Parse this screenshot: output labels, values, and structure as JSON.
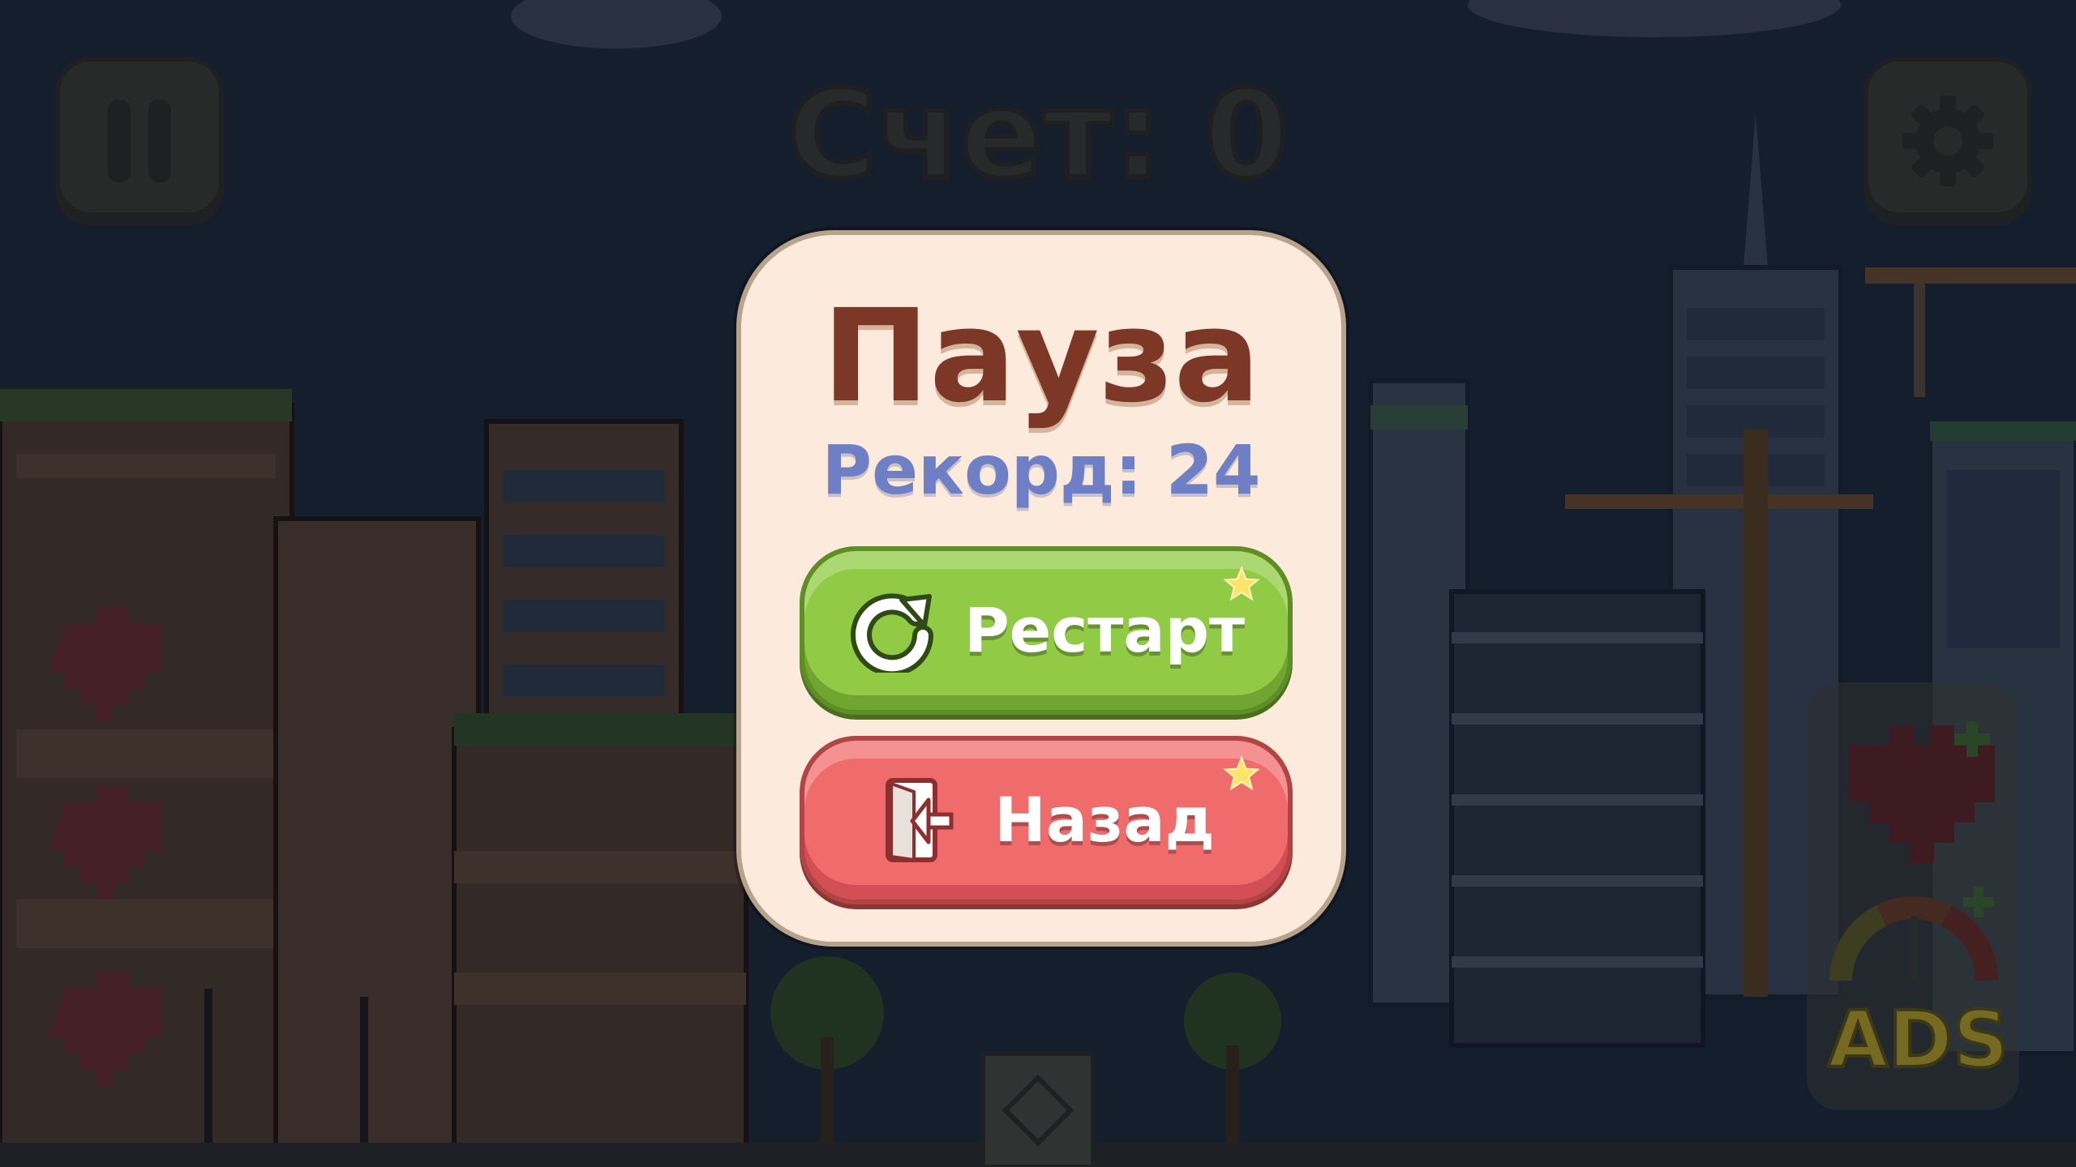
{
  "hud": {
    "score_label": "Счет: 0",
    "pause_icon": "pause-icon",
    "settings_icon": "gear-icon"
  },
  "pause_dialog": {
    "title": "Пауза",
    "record": "Рекорд: 24",
    "restart_label": "Рестарт",
    "back_label": "Назад",
    "restart_icon": "restart-icon",
    "back_icon": "exit-door-icon"
  },
  "side_panel": {
    "ads_label": "ADS",
    "heart_plus_icon": "heart-plus-icon",
    "speed_gauge_icon": "speed-gauge-plus-icon"
  },
  "lives": {
    "count": 3
  },
  "colors": {
    "restart_button": "#91cb45",
    "back_button": "#f06c6c",
    "panel": "#fcebdc",
    "title": "#7c3726",
    "record": "#6e7fc5"
  }
}
